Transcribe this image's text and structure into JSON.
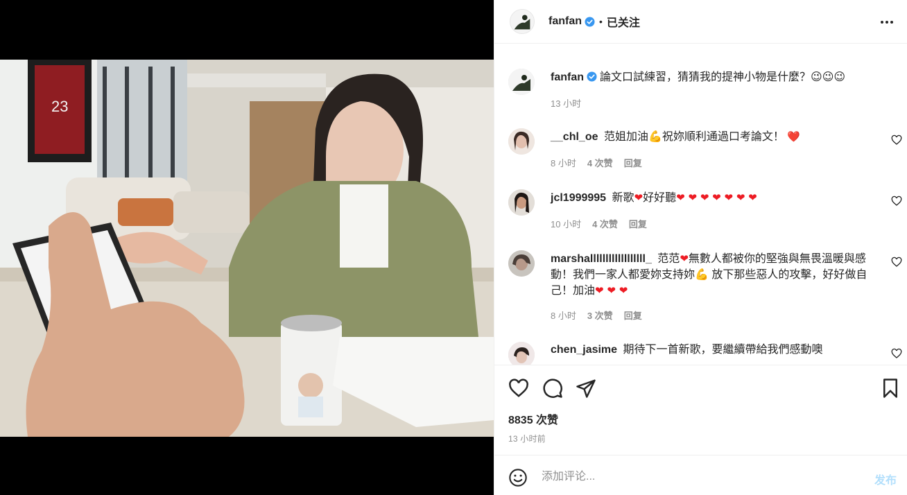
{
  "header": {
    "username": "fanfan",
    "separator": "•",
    "follow_state": "已关注"
  },
  "caption": {
    "username": "fanfan",
    "text": "論文口試練習，猜猜我的提神小物是什麼？",
    "emojis": "😉😉😉",
    "time": "13 小时"
  },
  "comments": [
    {
      "username": "__chl_oe",
      "text_a": "范姐加油",
      "emoji_a": "💪",
      "text_b": "祝妳順利通過口考論文！",
      "emoji_b": "❤️",
      "time": "8 小时",
      "likes": "4 次赞",
      "reply": "回复"
    },
    {
      "username": "jcl1999995",
      "text_a": "新歌",
      "emoji_a": "❤",
      "text_b": "好好聽",
      "emoji_b": "❤ ❤ ❤ ❤ ❤ ❤ ❤",
      "time": "10 小时",
      "likes": "4 次赞",
      "reply": "回复"
    },
    {
      "username": "marshallllllllllllllllll_",
      "text_a": "范范",
      "emoji_a": "❤",
      "text_b": "無數人都被你的堅強與無畏溫暖與感動！我們一家人都愛妳支持妳",
      "emoji_b": "💪",
      "text_c": " 放下那些惡人的攻擊，好好做自己！加油",
      "emoji_c": "❤ ❤ ❤",
      "time": "8 小时",
      "likes": "3 次赞",
      "reply": "回复"
    },
    {
      "username": "chen_jasime",
      "text_a": "期待下一首新歌，要繼續帶給我們感動噢"
    }
  ],
  "stats": {
    "likes": "8835 次赞",
    "time": "13 小时前"
  },
  "composer": {
    "placeholder": "添加评论...",
    "post_label": "发布"
  },
  "icons": {
    "like": "heart-outline-icon",
    "comment": "comment-bubble-icon",
    "share": "paper-plane-icon",
    "save": "bookmark-icon",
    "emoji": "smiley-icon",
    "more": "more-dots-icon",
    "verified": "verified-badge-icon"
  },
  "colors": {
    "verified": "#3897f0",
    "heart": "#ed1c24",
    "post_disabled": "#b2dffc",
    "meta": "#8e8e8e"
  }
}
